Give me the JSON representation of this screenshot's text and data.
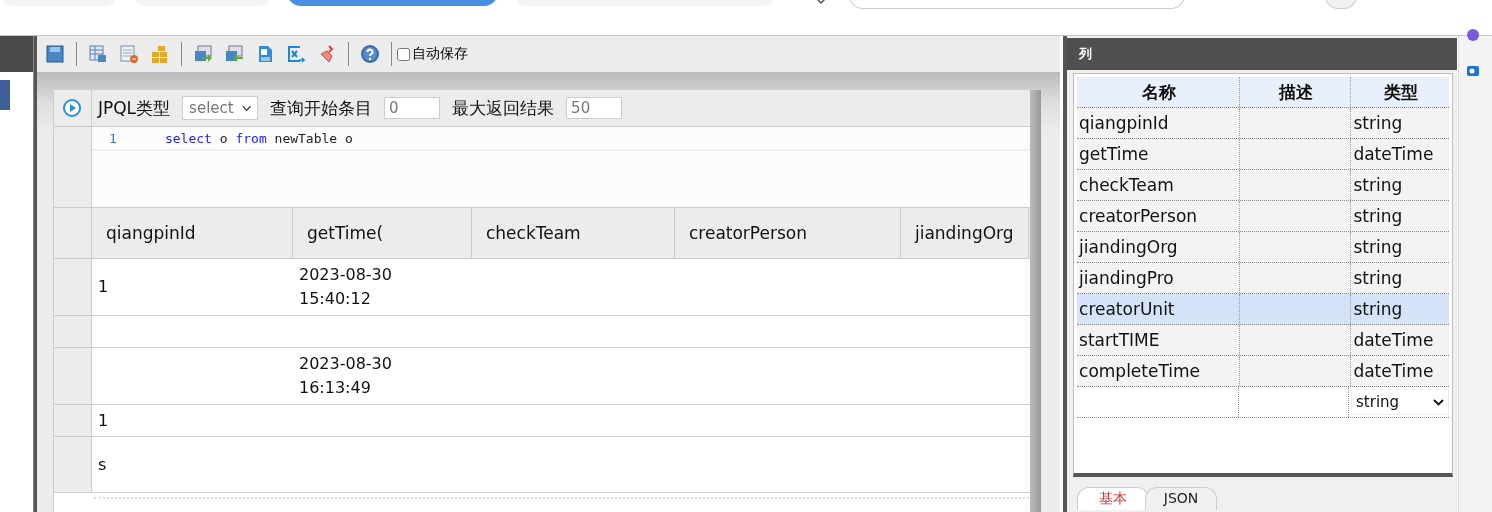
{
  "browser_tabs": [
    {
      "selected": false
    },
    {
      "selected": false
    },
    {
      "selected": true
    },
    {
      "selected": false
    }
  ],
  "toolbar": {
    "autosave": {
      "label": "自动保存",
      "checked": false
    }
  },
  "query": {
    "type_label": "JPQL类型",
    "type_value": "select",
    "start_label": "查询开始条目",
    "start_value": "0",
    "max_label": "最大返回结果",
    "max_value": "50"
  },
  "editor": {
    "lines": [
      {
        "number": "1",
        "tokens": [
          {
            "text": "select",
            "kind": "keyword"
          },
          {
            "text": "o",
            "kind": "plain"
          },
          {
            "text": "from",
            "kind": "keyword"
          },
          {
            "text": "newTable",
            "kind": "plain"
          },
          {
            "text": "o",
            "kind": "plain"
          }
        ]
      }
    ]
  },
  "results": {
    "columns": [
      "qiangpinId",
      "getTime(",
      "checkTeam",
      "creatorPerson",
      "jiandingOrg"
    ],
    "rows": [
      {
        "column_1": "1",
        "column_2": "2023-08-30 15:40:12"
      },
      {},
      {
        "column_2": "2023-08-30 16:13:49"
      },
      {
        "column_1": "1"
      },
      {
        "column_1": "s"
      }
    ]
  },
  "columns_panel": {
    "title": "列",
    "headers": [
      "名称",
      "描述",
      "类型"
    ],
    "fields": [
      {
        "name": "qiangpinId",
        "type": "string",
        "selected": false
      },
      {
        "name": "getTime",
        "type": "dateTime",
        "selected": false
      },
      {
        "name": "checkTeam",
        "type": "string",
        "selected": false
      },
      {
        "name": "creatorPerson",
        "type": "string",
        "selected": false
      },
      {
        "name": "jiandingOrg",
        "type": "string",
        "selected": false
      },
      {
        "name": "jiandingPro",
        "type": "string",
        "selected": false
      },
      {
        "name": "creatorUnit",
        "type": "string",
        "selected": true
      },
      {
        "name": "startTIME",
        "type": "dateTime",
        "selected": false
      },
      {
        "name": "completeTime",
        "type": "dateTime",
        "selected": false
      }
    ],
    "new_field_type": "string",
    "tabs": [
      {
        "label": "基本",
        "selected": true
      },
      {
        "label": "JSON",
        "selected": false
      }
    ]
  }
}
